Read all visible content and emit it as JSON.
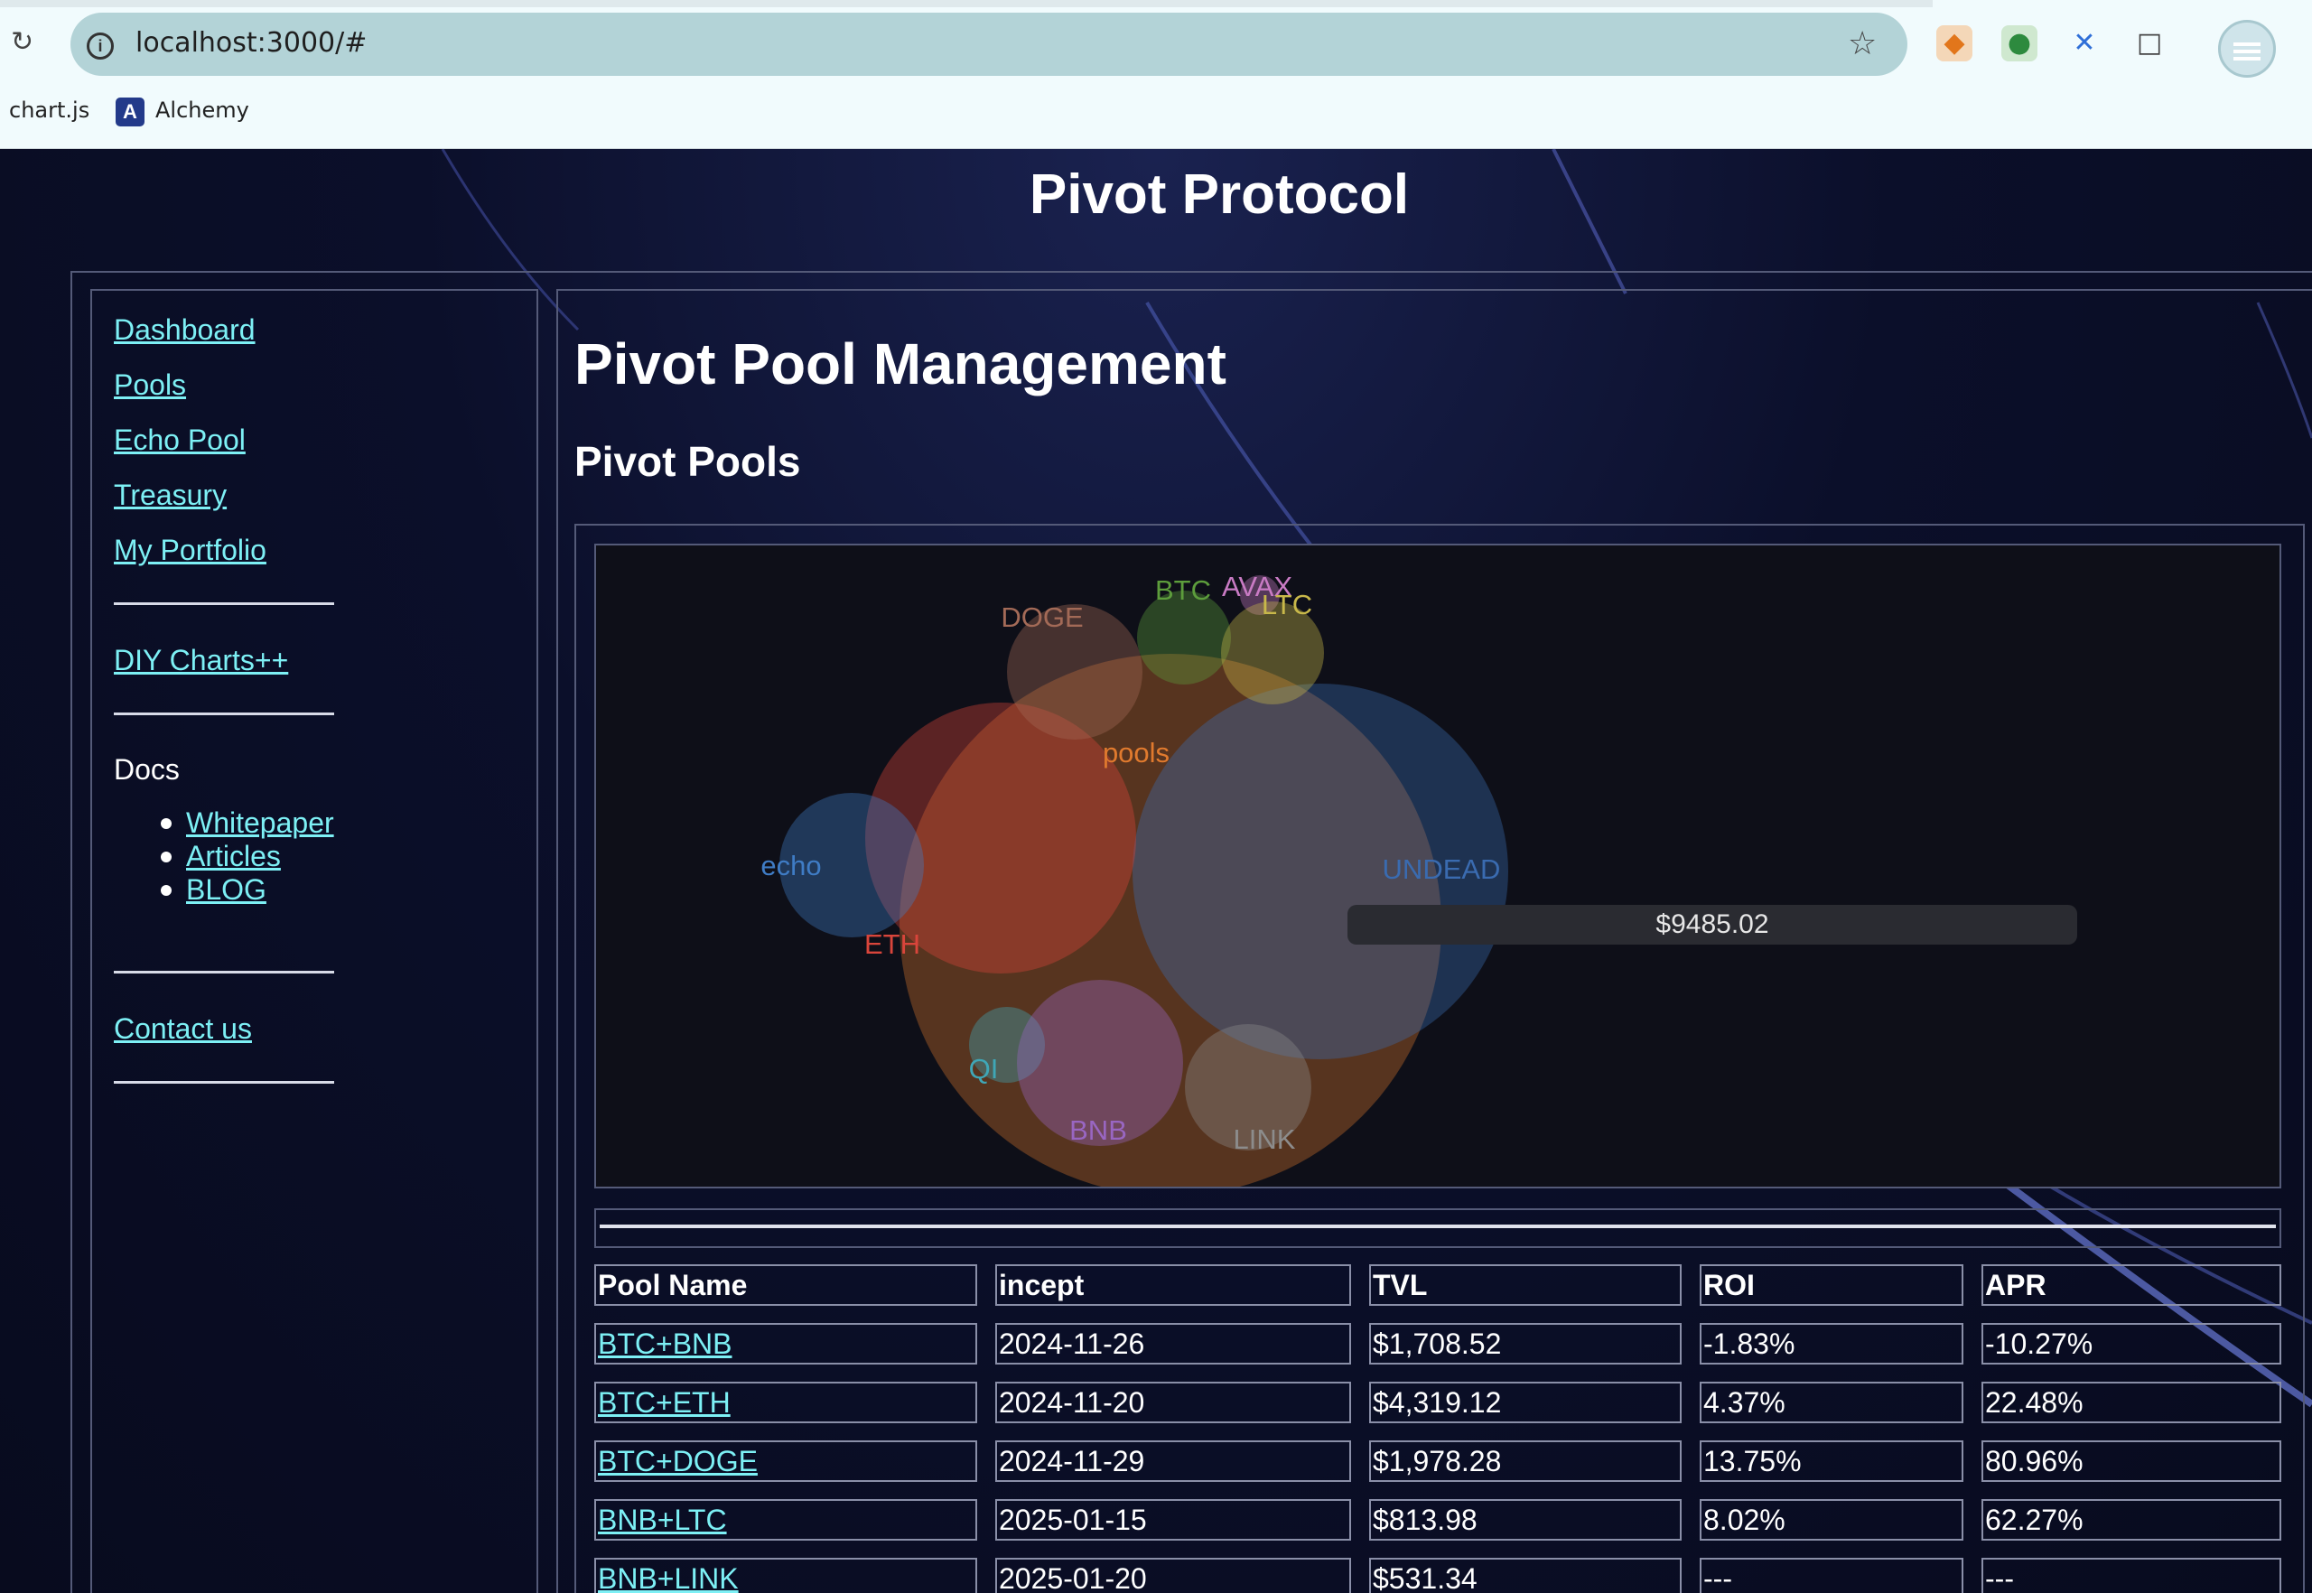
{
  "browser": {
    "url": "localhost:3000/#",
    "bookmarks": [
      "chart.js",
      "Alchemy"
    ]
  },
  "site": {
    "title": "Pivot Protocol"
  },
  "nav": {
    "links": [
      "Dashboard",
      "Pools",
      "Echo Pool",
      "Treasury",
      "My Portfolio"
    ],
    "diy": "DIY Charts++",
    "docs_label": "Docs",
    "docs": [
      "Whitepaper",
      "Articles",
      "BLOG"
    ],
    "contact": "Contact us"
  },
  "main": {
    "heading": "Pivot Pool Management",
    "subheading": "Pivot Pools"
  },
  "chart_data": {
    "type": "bubble-pack",
    "root": "pools",
    "nodes": [
      {
        "name": "pools",
        "color": "#e07a2e"
      },
      {
        "name": "UNDEAD",
        "color": "#3a6bb0"
      },
      {
        "name": "ETH",
        "color": "#d9453b"
      },
      {
        "name": "echo",
        "color": "#3f7cc5"
      },
      {
        "name": "DOGE",
        "color": "#a36a57"
      },
      {
        "name": "BTC",
        "color": "#5d9d3c"
      },
      {
        "name": "AVAX",
        "color": "#c97bc4"
      },
      {
        "name": "LTC",
        "color": "#c8b84a"
      },
      {
        "name": "QI",
        "color": "#3fa7b7"
      },
      {
        "name": "BNB",
        "color": "#9966c2"
      },
      {
        "name": "LINK",
        "color": "#8c8c8c"
      }
    ],
    "tooltip": "$9485.02"
  },
  "table": {
    "headers": [
      "Pool Name",
      "incept",
      "TVL",
      "ROI",
      "APR"
    ],
    "rows": [
      [
        "BTC+BNB",
        "2024-11-26",
        "$1,708.52",
        "-1.83%",
        "-10.27%"
      ],
      [
        "BTC+ETH",
        "2024-11-20",
        "$4,319.12",
        "4.37%",
        "22.48%"
      ],
      [
        "BTC+DOGE",
        "2024-11-29",
        "$1,978.28",
        "13.75%",
        "80.96%"
      ],
      [
        "BNB+LTC",
        "2025-01-15",
        "$813.98",
        "8.02%",
        "62.27%"
      ],
      [
        "BNB+LINK",
        "2025-01-20",
        "$531.34",
        "---",
        "---"
      ]
    ]
  }
}
